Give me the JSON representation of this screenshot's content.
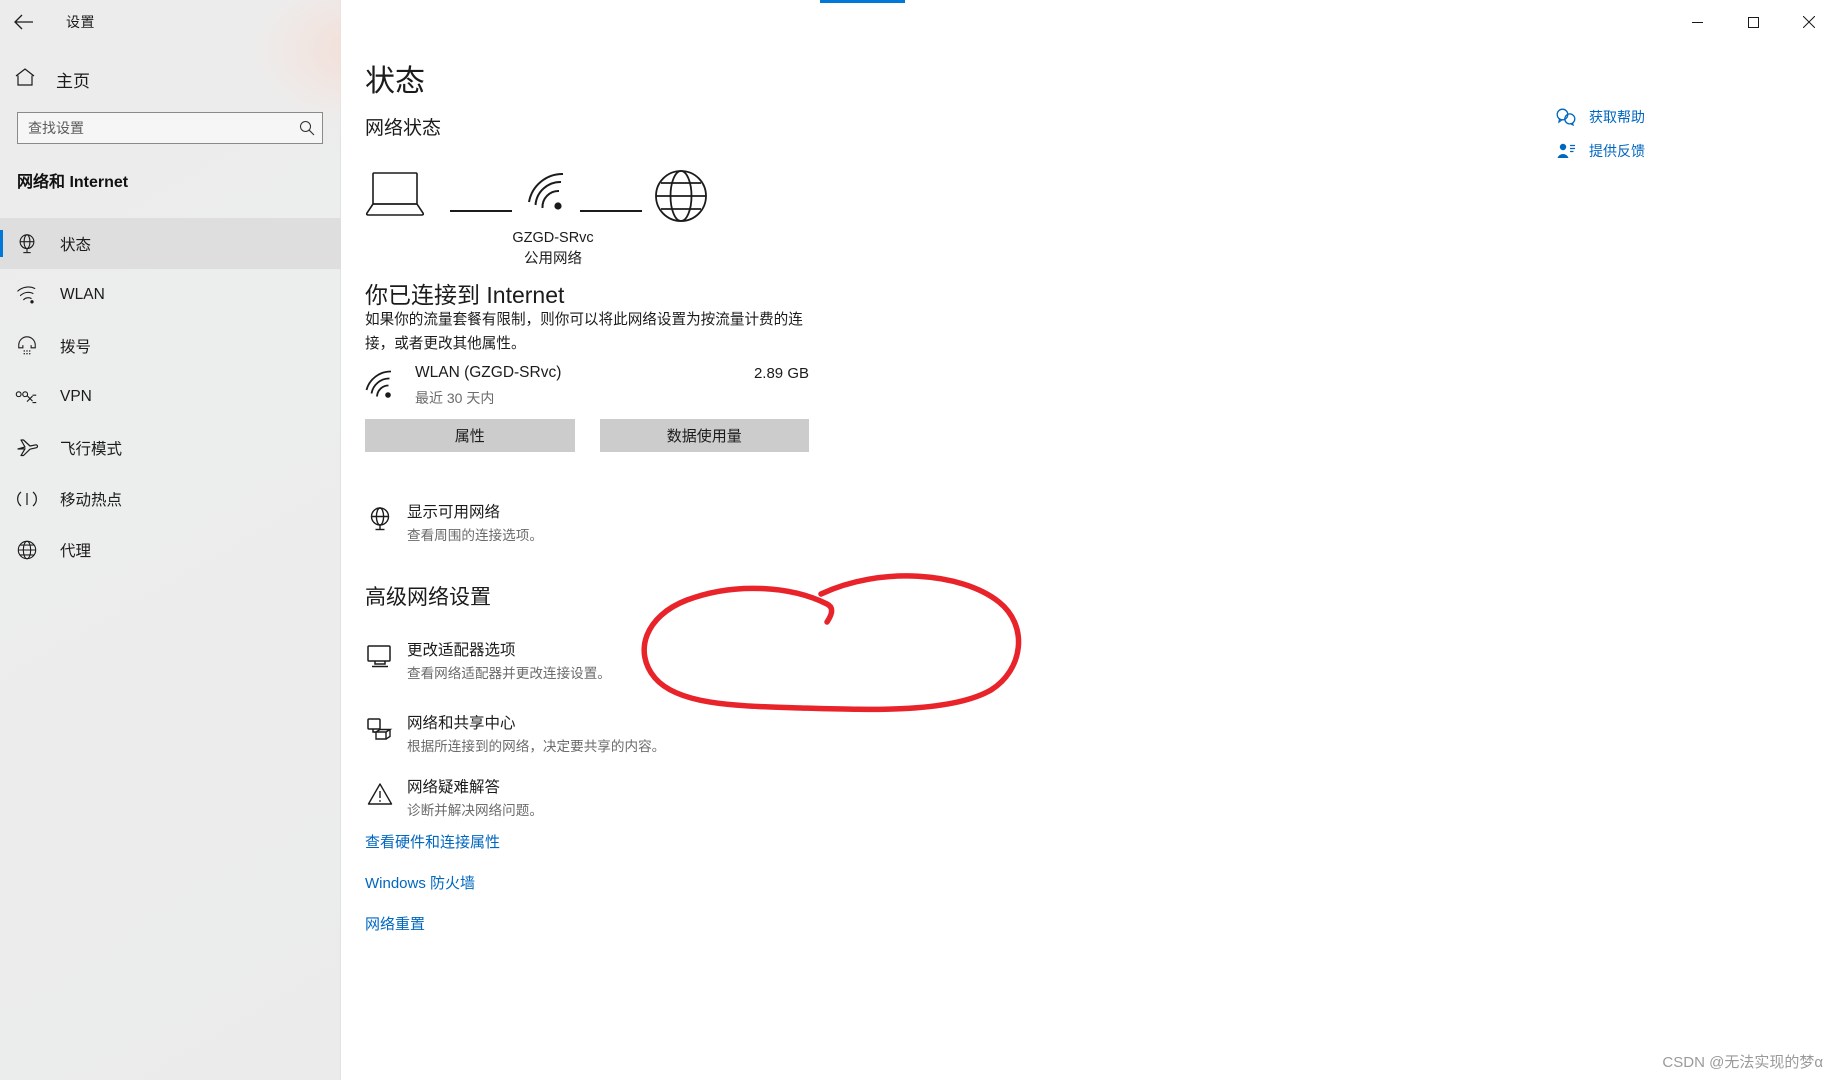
{
  "window": {
    "app_title": "设置",
    "back_icon": "back-arrow-icon",
    "minimize_label": "─",
    "maximize_label": "□",
    "close_label": "✕",
    "accent_color": "#0078d7"
  },
  "sidebar": {
    "home_label": "主页",
    "home_icon": "home-icon",
    "search": {
      "placeholder": "查找设置",
      "value": "",
      "icon": "search-icon"
    },
    "category_title": "网络和 Internet",
    "items": [
      {
        "label": "状态",
        "icon": "network-status-icon",
        "selected": true
      },
      {
        "label": "WLAN",
        "icon": "wifi-icon",
        "selected": false
      },
      {
        "label": "拨号",
        "icon": "dialup-phone-icon",
        "selected": false
      },
      {
        "label": "VPN",
        "icon": "vpn-icon",
        "selected": false
      },
      {
        "label": "飞行模式",
        "icon": "airplane-icon",
        "selected": false
      },
      {
        "label": "移动热点",
        "icon": "hotspot-icon",
        "selected": false
      },
      {
        "label": "代理",
        "icon": "proxy-globe-icon",
        "selected": false
      }
    ]
  },
  "main": {
    "page_title": "状态",
    "section_subtitle": "网络状态",
    "help_links": [
      {
        "label": "获取帮助",
        "icon": "help-chat-icon"
      },
      {
        "label": "提供反馈",
        "icon": "feedback-person-icon"
      }
    ],
    "diagram": {
      "device_icon": "laptop-icon",
      "network_icon": "wifi-icon",
      "internet_icon": "globe-icon",
      "network_name": "GZGD-SRvc",
      "network_type": "公用网络"
    },
    "connected_heading": "你已连接到 Internet",
    "connected_description": "如果你的流量套餐有限制，则你可以将此网络设置为按流量计费的连接，或者更改其他属性。",
    "usage": {
      "icon": "wifi-icon",
      "title": "WLAN (GZGD-SRvc)",
      "subtitle": "最近 30 天内",
      "amount": "2.89 GB"
    },
    "buttons": [
      {
        "label": "属性"
      },
      {
        "label": "数据使用量"
      }
    ],
    "show_networks": {
      "icon": "available-networks-icon",
      "title": "显示可用网络",
      "desc": "查看周围的连接选项。"
    },
    "advanced_heading": "高级网络设置",
    "advanced_items": [
      {
        "icon": "monitor-adapter-icon",
        "title": "更改适配器选项",
        "desc": "查看网络适配器并更改连接设置。",
        "highlighted": true
      },
      {
        "icon": "sharing-center-icon",
        "title": "网络和共享中心",
        "desc": "根据所连接到的网络，决定要共享的内容。",
        "highlighted": false
      },
      {
        "icon": "warning-triangle-icon",
        "title": "网络疑难解答",
        "desc": "诊断并解决网络问题。",
        "highlighted": false
      }
    ],
    "footer_links": [
      {
        "label": "查看硬件和连接属性"
      },
      {
        "label": "Windows 防火墙"
      },
      {
        "label": "网络重置"
      }
    ],
    "annotation": {
      "shape": "hand-drawn-red-ellipse",
      "color": "#e8232a"
    }
  },
  "watermark": "CSDN @无法实现的梦α"
}
